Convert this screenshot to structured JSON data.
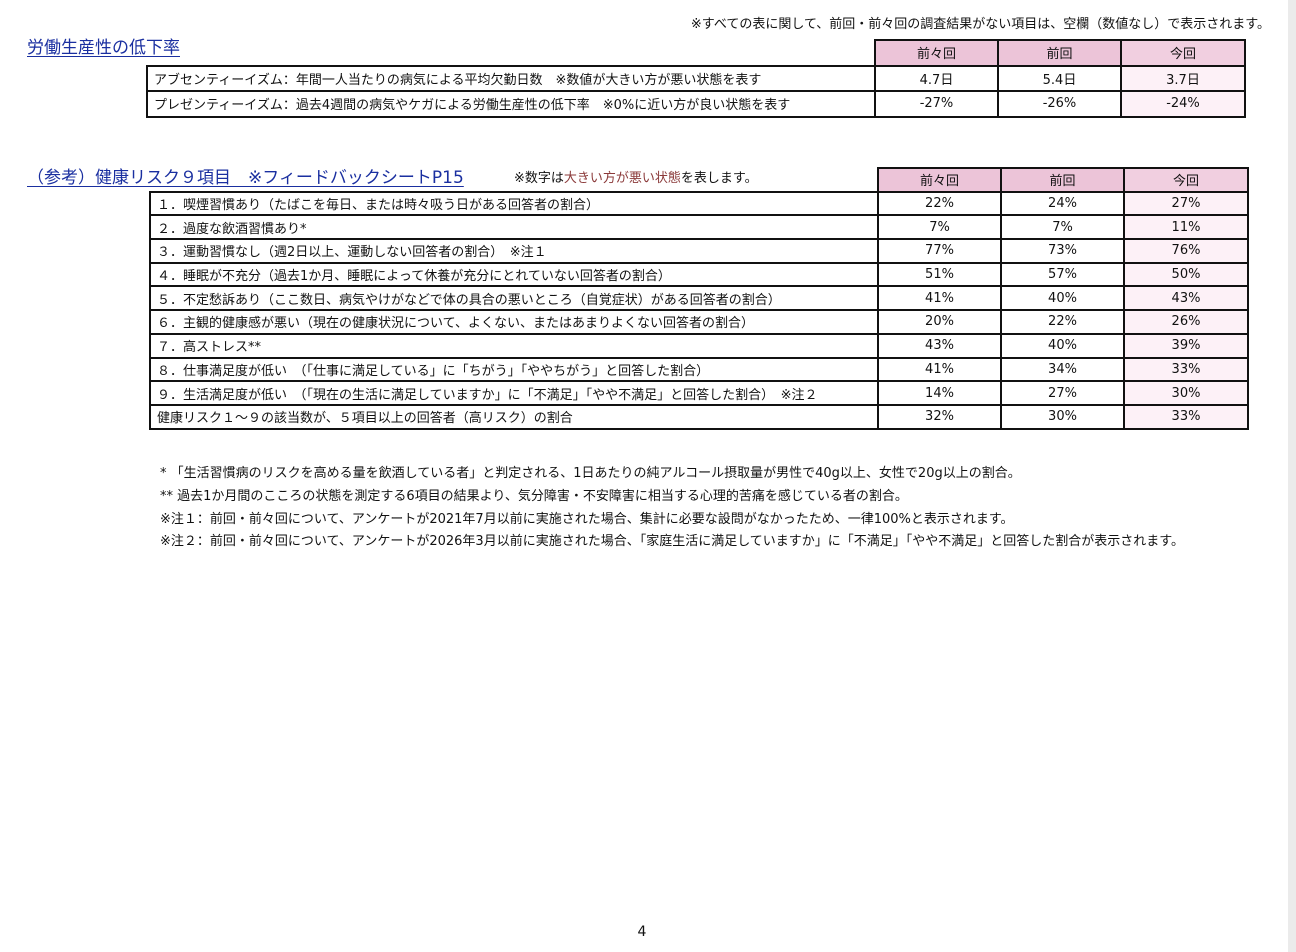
{
  "top_note": "※すべての表に関して、前回・前々回の調査結果がない項目は、空欄（数値なし）で表示されます。",
  "productivity": {
    "title": "労働生産性の低下率",
    "headers": [
      "前々回",
      "前回",
      "今回"
    ],
    "rows": [
      {
        "label": "アブセンティーイズム：年間一人当たりの病気による平均欠勤日数　※数値が大きい方が悪い状態を表す",
        "values": [
          "4.7日",
          "5.4日",
          "3.7日"
        ]
      },
      {
        "label": "プレゼンティーイズム：過去4週間の病気やケガによる労働生産性の低下率　※0%に近い方が良い状態を表す",
        "values": [
          "-27%",
          "-26%",
          "-24%"
        ]
      }
    ]
  },
  "health_risk": {
    "title": "（参考）健康リスク９項目　※フィードバックシートP15",
    "legend_prefix": "※数字は",
    "legend_highlight": "大きい方が悪い状態",
    "legend_suffix": "を表します。",
    "headers": [
      "前々回",
      "前回",
      "今回"
    ],
    "rows": [
      {
        "label": "１．喫煙習慣あり（たばこを毎日、または時々吸う日がある回答者の割合）",
        "values": [
          "22%",
          "24%",
          "27%"
        ]
      },
      {
        "label": "２．過度な飲酒習慣あり*",
        "values": [
          "7%",
          "7%",
          "11%"
        ]
      },
      {
        "label": "３．運動習慣なし（週2日以上、運動しない回答者の割合）　※注１",
        "values": [
          "77%",
          "73%",
          "76%"
        ]
      },
      {
        "label": "４．睡眠が不充分（過去1か月、睡眠によって休養が充分にとれていない回答者の割合）",
        "values": [
          "51%",
          "57%",
          "50%"
        ]
      },
      {
        "label": "５．不定愁訴あり（ここ数日、病気やけがなどで体の具合の悪いところ（自覚症状）がある回答者の割合）",
        "values": [
          "41%",
          "40%",
          "43%"
        ]
      },
      {
        "label": "６．主観的健康感が悪い（現在の健康状況について、よくない、またはあまりよくない回答者の割合）",
        "values": [
          "20%",
          "22%",
          "26%"
        ]
      },
      {
        "label": "７．高ストレス**",
        "values": [
          "43%",
          "40%",
          "39%"
        ]
      },
      {
        "label": "８．仕事満足度が低い　（「仕事に満足している」に「ちがう」「ややちがう」と回答した割合）",
        "values": [
          "41%",
          "34%",
          "33%"
        ]
      },
      {
        "label": "９．生活満足度が低い　（「現在の生活に満足していますか」に「不満足」「やや不満足」と回答した割合）　※注２",
        "values": [
          "14%",
          "27%",
          "30%"
        ]
      },
      {
        "label": "健康リスク１～９の該当数が、５項目以上の回答者（高リスク）の割合",
        "values": [
          "32%",
          "30%",
          "33%"
        ]
      }
    ]
  },
  "notes": [
    "* 「生活習慣病のリスクを高める量を飲酒している者」と判定される、1日あたりの純アルコール摂取量が男性で40g以上、女性で20g以上の割合。",
    "** 過去1か月間のこころの状態を測定する6項目の結果より、気分障害・不安障害に相当する心理的苦痛を感じている者の割合。",
    "※注１：前回・前々回について、アンケートが2021年7月以前に実施された場合、集計に必要な設問がなかったため、一律100%と表示されます。",
    "※注２：前回・前々回について、アンケートが2026年3月以前に実施された場合、「家庭生活に満足していますか」に「不満足」「やや不満足」と回答した割合が表示されます。"
  ],
  "page_number": "4",
  "colors": {
    "title_blue": "#1a2fa0",
    "header_pink": "#ecc4d8",
    "current_cell_pink": "#fdf1f7",
    "legend_highlight": "#8b3a3a"
  }
}
